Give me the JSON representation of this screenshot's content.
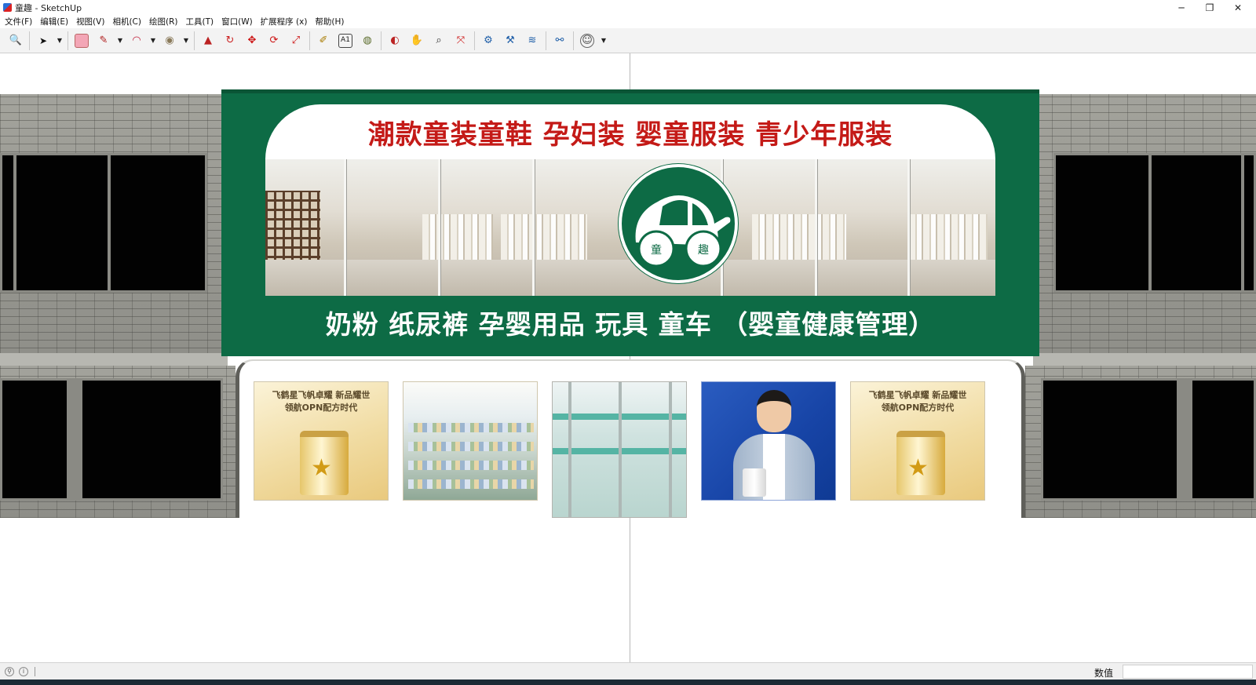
{
  "window": {
    "title": "童趣 - SketchUp",
    "minimize": "─",
    "restore": "❐",
    "close": "✕"
  },
  "menu": [
    "文件(F)",
    "编辑(E)",
    "视图(V)",
    "相机(C)",
    "绘图(R)",
    "工具(T)",
    "窗口(W)",
    "扩展程序 (x)",
    "帮助(H)"
  ],
  "toolbar": {
    "tools": [
      {
        "name": "zoom-extents-icon",
        "glyph": "🔍"
      },
      {
        "name": "select-icon",
        "glyph": "➤"
      },
      {
        "name": "eraser-icon",
        "glyph": "▰"
      },
      {
        "name": "line-pencil-icon",
        "glyph": "✎"
      },
      {
        "name": "arc-icon",
        "glyph": "◠"
      },
      {
        "name": "circle-icon",
        "glyph": "◉"
      },
      {
        "name": "push-pull-icon",
        "glyph": "▲"
      },
      {
        "name": "follow-me-icon",
        "glyph": "↻"
      },
      {
        "name": "move-icon",
        "glyph": "✥"
      },
      {
        "name": "rotate-icon",
        "glyph": "⟳"
      },
      {
        "name": "scale-icon",
        "glyph": "⤢"
      },
      {
        "name": "tape-measure-icon",
        "glyph": "✐"
      },
      {
        "name": "text-icon",
        "glyph": "A"
      },
      {
        "name": "paint-bucket-icon",
        "glyph": "◍"
      },
      {
        "name": "orbit-icon",
        "glyph": "◐"
      },
      {
        "name": "pan-icon",
        "glyph": "✋"
      },
      {
        "name": "zoom-icon",
        "glyph": "⌕"
      },
      {
        "name": "zoom-window-icon",
        "glyph": "⤧"
      },
      {
        "name": "warehouse-icon",
        "glyph": "⚙"
      },
      {
        "name": "extension-warehouse-icon",
        "glyph": "⚒"
      },
      {
        "name": "layers-icon",
        "glyph": "≋"
      },
      {
        "name": "trimble-connect-icon",
        "glyph": "⚯"
      },
      {
        "name": "account-icon",
        "glyph": "☺"
      }
    ]
  },
  "model": {
    "sign_top_text": "潮款童装童鞋 孕妇装 婴童服装 青少年服装",
    "sign_bottom_text": "奶粉 纸尿裤 孕婴用品 玩具 童车 （婴童健康管理）",
    "logo_chars": [
      "童",
      "趣"
    ],
    "brand_green": "#0d6b45",
    "headline_red": "#c41a17",
    "posters": [
      {
        "type": "milk",
        "line1": "飞鹤星飞帆卓耀 新品耀世",
        "line2": "领航OPN配方时代"
      },
      {
        "type": "shelf"
      },
      {
        "type": "door"
      },
      {
        "type": "ad"
      },
      {
        "type": "milk",
        "line1": "飞鹤星飞帆卓耀 新品耀世",
        "line2": "领航OPN配方时代"
      }
    ]
  },
  "status": {
    "measurements_label": "数值",
    "measurements_value": ""
  }
}
